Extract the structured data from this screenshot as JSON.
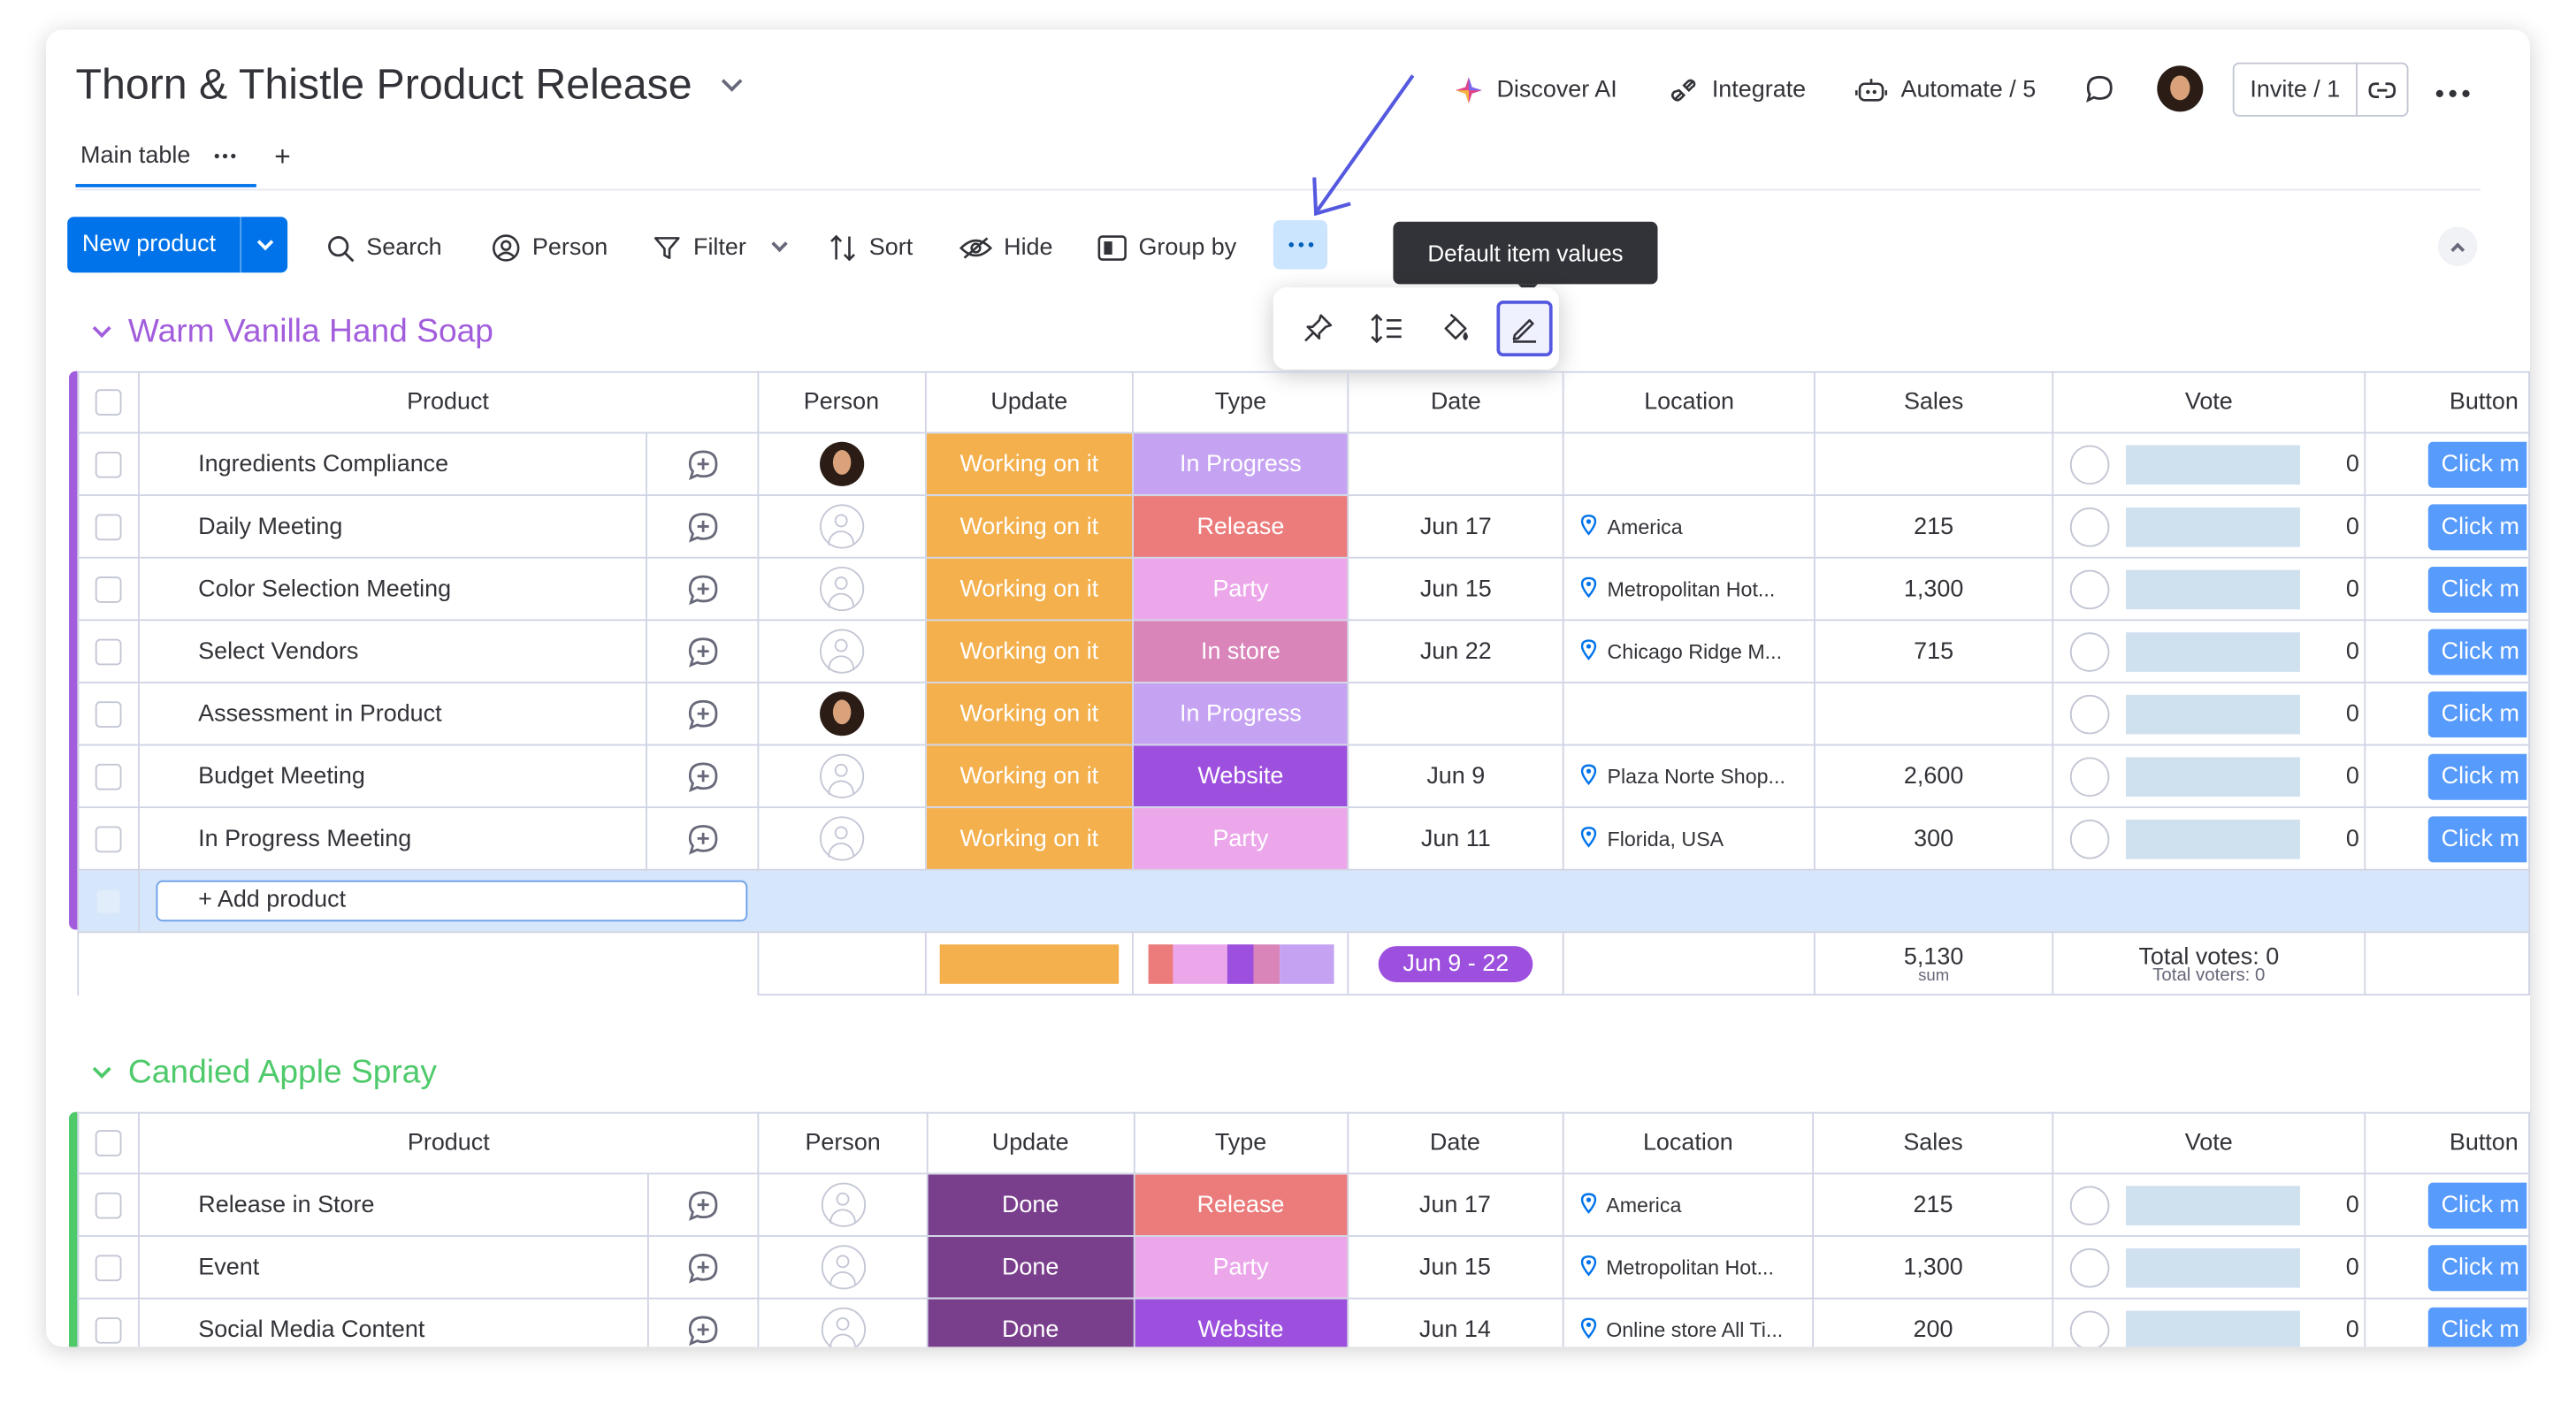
{
  "header": {
    "board_title": "Thorn & Thistle Product Release",
    "discover_ai": "Discover AI",
    "integrate": "Integrate",
    "automate": "Automate / 5",
    "invite": "Invite / 1"
  },
  "tabs": {
    "main": "Main table",
    "add": "+"
  },
  "toolbar": {
    "new_item": "New product",
    "search": "Search",
    "person": "Person",
    "filter": "Filter",
    "sort": "Sort",
    "hide": "Hide",
    "group_by": "Group by",
    "more": "…"
  },
  "tooltip": "Default item values",
  "columns": [
    "Product",
    "Person",
    "Update",
    "Type",
    "Date",
    "Location",
    "Sales",
    "Vote",
    "Button"
  ],
  "groups": [
    {
      "title": "Warm Vanilla Hand Soap",
      "color": "#a25ddc",
      "rows": [
        {
          "name": "Ingredients Compliance",
          "person": "photo",
          "update": "Working on it",
          "type": "In Progress",
          "type_color": "#c5a3f2",
          "date": "",
          "location": "",
          "sales": "",
          "votes": "0",
          "button": "Click m"
        },
        {
          "name": "Daily Meeting",
          "person": "empty",
          "update": "Working on it",
          "type": "Release",
          "type_color": "#ec7b7b",
          "date": "Jun 17",
          "location": "America",
          "sales": "215",
          "votes": "0",
          "button": "Click m"
        },
        {
          "name": "Color Selection Meeting",
          "person": "empty",
          "update": "Working on it",
          "type": "Party",
          "type_color": "#eca7eb",
          "date": "Jun 15",
          "location": "Metropolitan Hot...",
          "sales": "1,300",
          "votes": "0",
          "button": "Click m"
        },
        {
          "name": "Select Vendors",
          "person": "empty",
          "update": "Working on it",
          "type": "In store",
          "type_color": "#d985ba",
          "date": "Jun 22",
          "location": "Chicago Ridge M...",
          "sales": "715",
          "votes": "0",
          "button": "Click m"
        },
        {
          "name": "Assessment in Product",
          "person": "photo",
          "update": "Working on it",
          "type": "In Progress",
          "type_color": "#c5a3f2",
          "date": "",
          "location": "",
          "sales": "",
          "votes": "0",
          "button": "Click m"
        },
        {
          "name": "Budget Meeting",
          "person": "empty",
          "update": "Working on it",
          "type": "Website",
          "type_color": "#9d50dd",
          "date": "Jun 9",
          "location": "Plaza Norte Shop...",
          "sales": "2,600",
          "votes": "0",
          "button": "Click m"
        },
        {
          "name": "In Progress Meeting",
          "person": "empty",
          "update": "Working on it",
          "type": "Party",
          "type_color": "#eca7eb",
          "date": "Jun 11",
          "location": "Florida, USA",
          "sales": "300",
          "votes": "0",
          "button": "Click m"
        }
      ],
      "add_item": "+ Add product",
      "summary": {
        "date_range": "Jun 9 - 22",
        "sales_sum": "5,130",
        "sales_sum_label": "sum",
        "total_votes": "Total votes: 0",
        "total_voters": "Total voters: 0",
        "type_segments": [
          {
            "color": "#ec7b7b",
            "fraction": 0.14
          },
          {
            "color": "#eca7eb",
            "fraction": 0.29
          },
          {
            "color": "#9d50dd",
            "fraction": 0.14
          },
          {
            "color": "#d985ba",
            "fraction": 0.14
          },
          {
            "color": "#c5a3f2",
            "fraction": 0.29
          }
        ]
      }
    },
    {
      "title": "Candied Apple Spray",
      "color": "#4eca6a",
      "rows": [
        {
          "name": "Release in Store",
          "person": "empty",
          "update": "Done",
          "type": "Release",
          "type_color": "#ec7b7b",
          "date": "Jun 17",
          "location": "America",
          "sales": "215",
          "votes": "0",
          "button": "Click m"
        },
        {
          "name": "Event",
          "person": "empty",
          "update": "Done",
          "type": "Party",
          "type_color": "#eca7eb",
          "date": "Jun 15",
          "location": "Metropolitan Hot...",
          "sales": "1,300",
          "votes": "0",
          "button": "Click m"
        },
        {
          "name": "Social Media Content",
          "person": "empty",
          "update": "Done",
          "type": "Website",
          "type_color": "#9d50dd",
          "date": "Jun 14",
          "location": "Online store All Ti...",
          "sales": "200",
          "votes": "0",
          "button": "Click m"
        }
      ]
    }
  ],
  "colors": {
    "primary": "#0073ea",
    "working_on_it": "#f3b04d",
    "done": "#7a3f8c",
    "date_pill": "#9d50dd",
    "arrow": "#5559df"
  },
  "icons": [
    "sparkle-icon",
    "integrate-icon",
    "robot-icon",
    "chat-icon",
    "link-icon",
    "more-icon",
    "search-icon",
    "person-icon",
    "filter-icon",
    "sort-icon",
    "eye-icon",
    "group-icon",
    "pin-icon",
    "row-height-icon",
    "paint-bucket-icon",
    "pen-icon",
    "add-update-icon",
    "location-pin-icon",
    "collapse-icon"
  ]
}
